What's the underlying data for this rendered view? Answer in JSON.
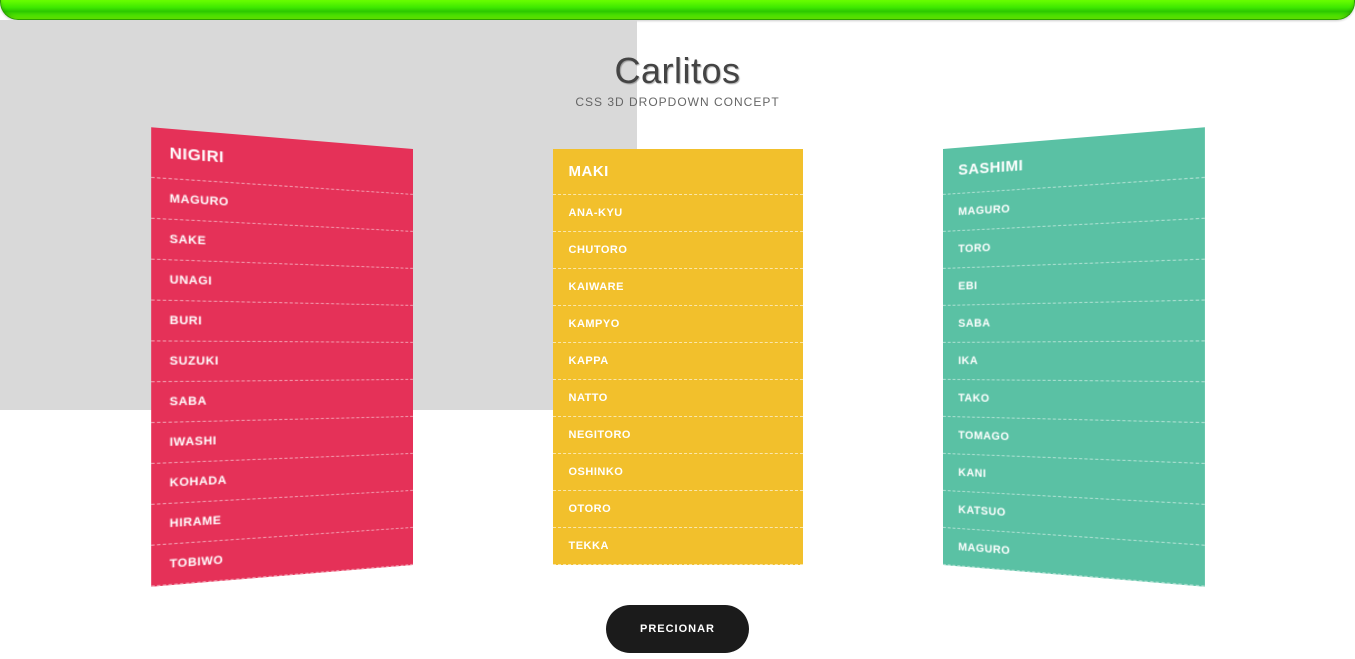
{
  "header": {
    "title": "Carlitos",
    "subtitle": "CSS 3D DROPDOWN CONCEPT"
  },
  "menus": [
    {
      "title": "NIGIRI",
      "items": [
        "MAGURO",
        "SAKE",
        "UNAGI",
        "BURI",
        "SUZUKI",
        "SABA",
        "IWASHI",
        "KOHADA",
        "HIRAME",
        "TOBIWO"
      ]
    },
    {
      "title": "MAKI",
      "items": [
        "ANA-KYU",
        "CHUTORO",
        "KAIWARE",
        "KAMPYO",
        "KAPPA",
        "NATTO",
        "NEGITORO",
        "OSHINKO",
        "OTORO",
        "TEKKA"
      ]
    },
    {
      "title": "SASHIMI",
      "items": [
        "MAGURO",
        "TORO",
        "EBI",
        "SABA",
        "IKA",
        "TAKO",
        "TOMAGO",
        "KANI",
        "KATSUO",
        "MAGURO"
      ]
    }
  ],
  "button": {
    "label": "PRECIONAR"
  },
  "colors": {
    "nigiri": "#e53158",
    "maki": "#f2c02c",
    "sashimi": "#5ac1a4",
    "topbar": "#3ee800"
  }
}
